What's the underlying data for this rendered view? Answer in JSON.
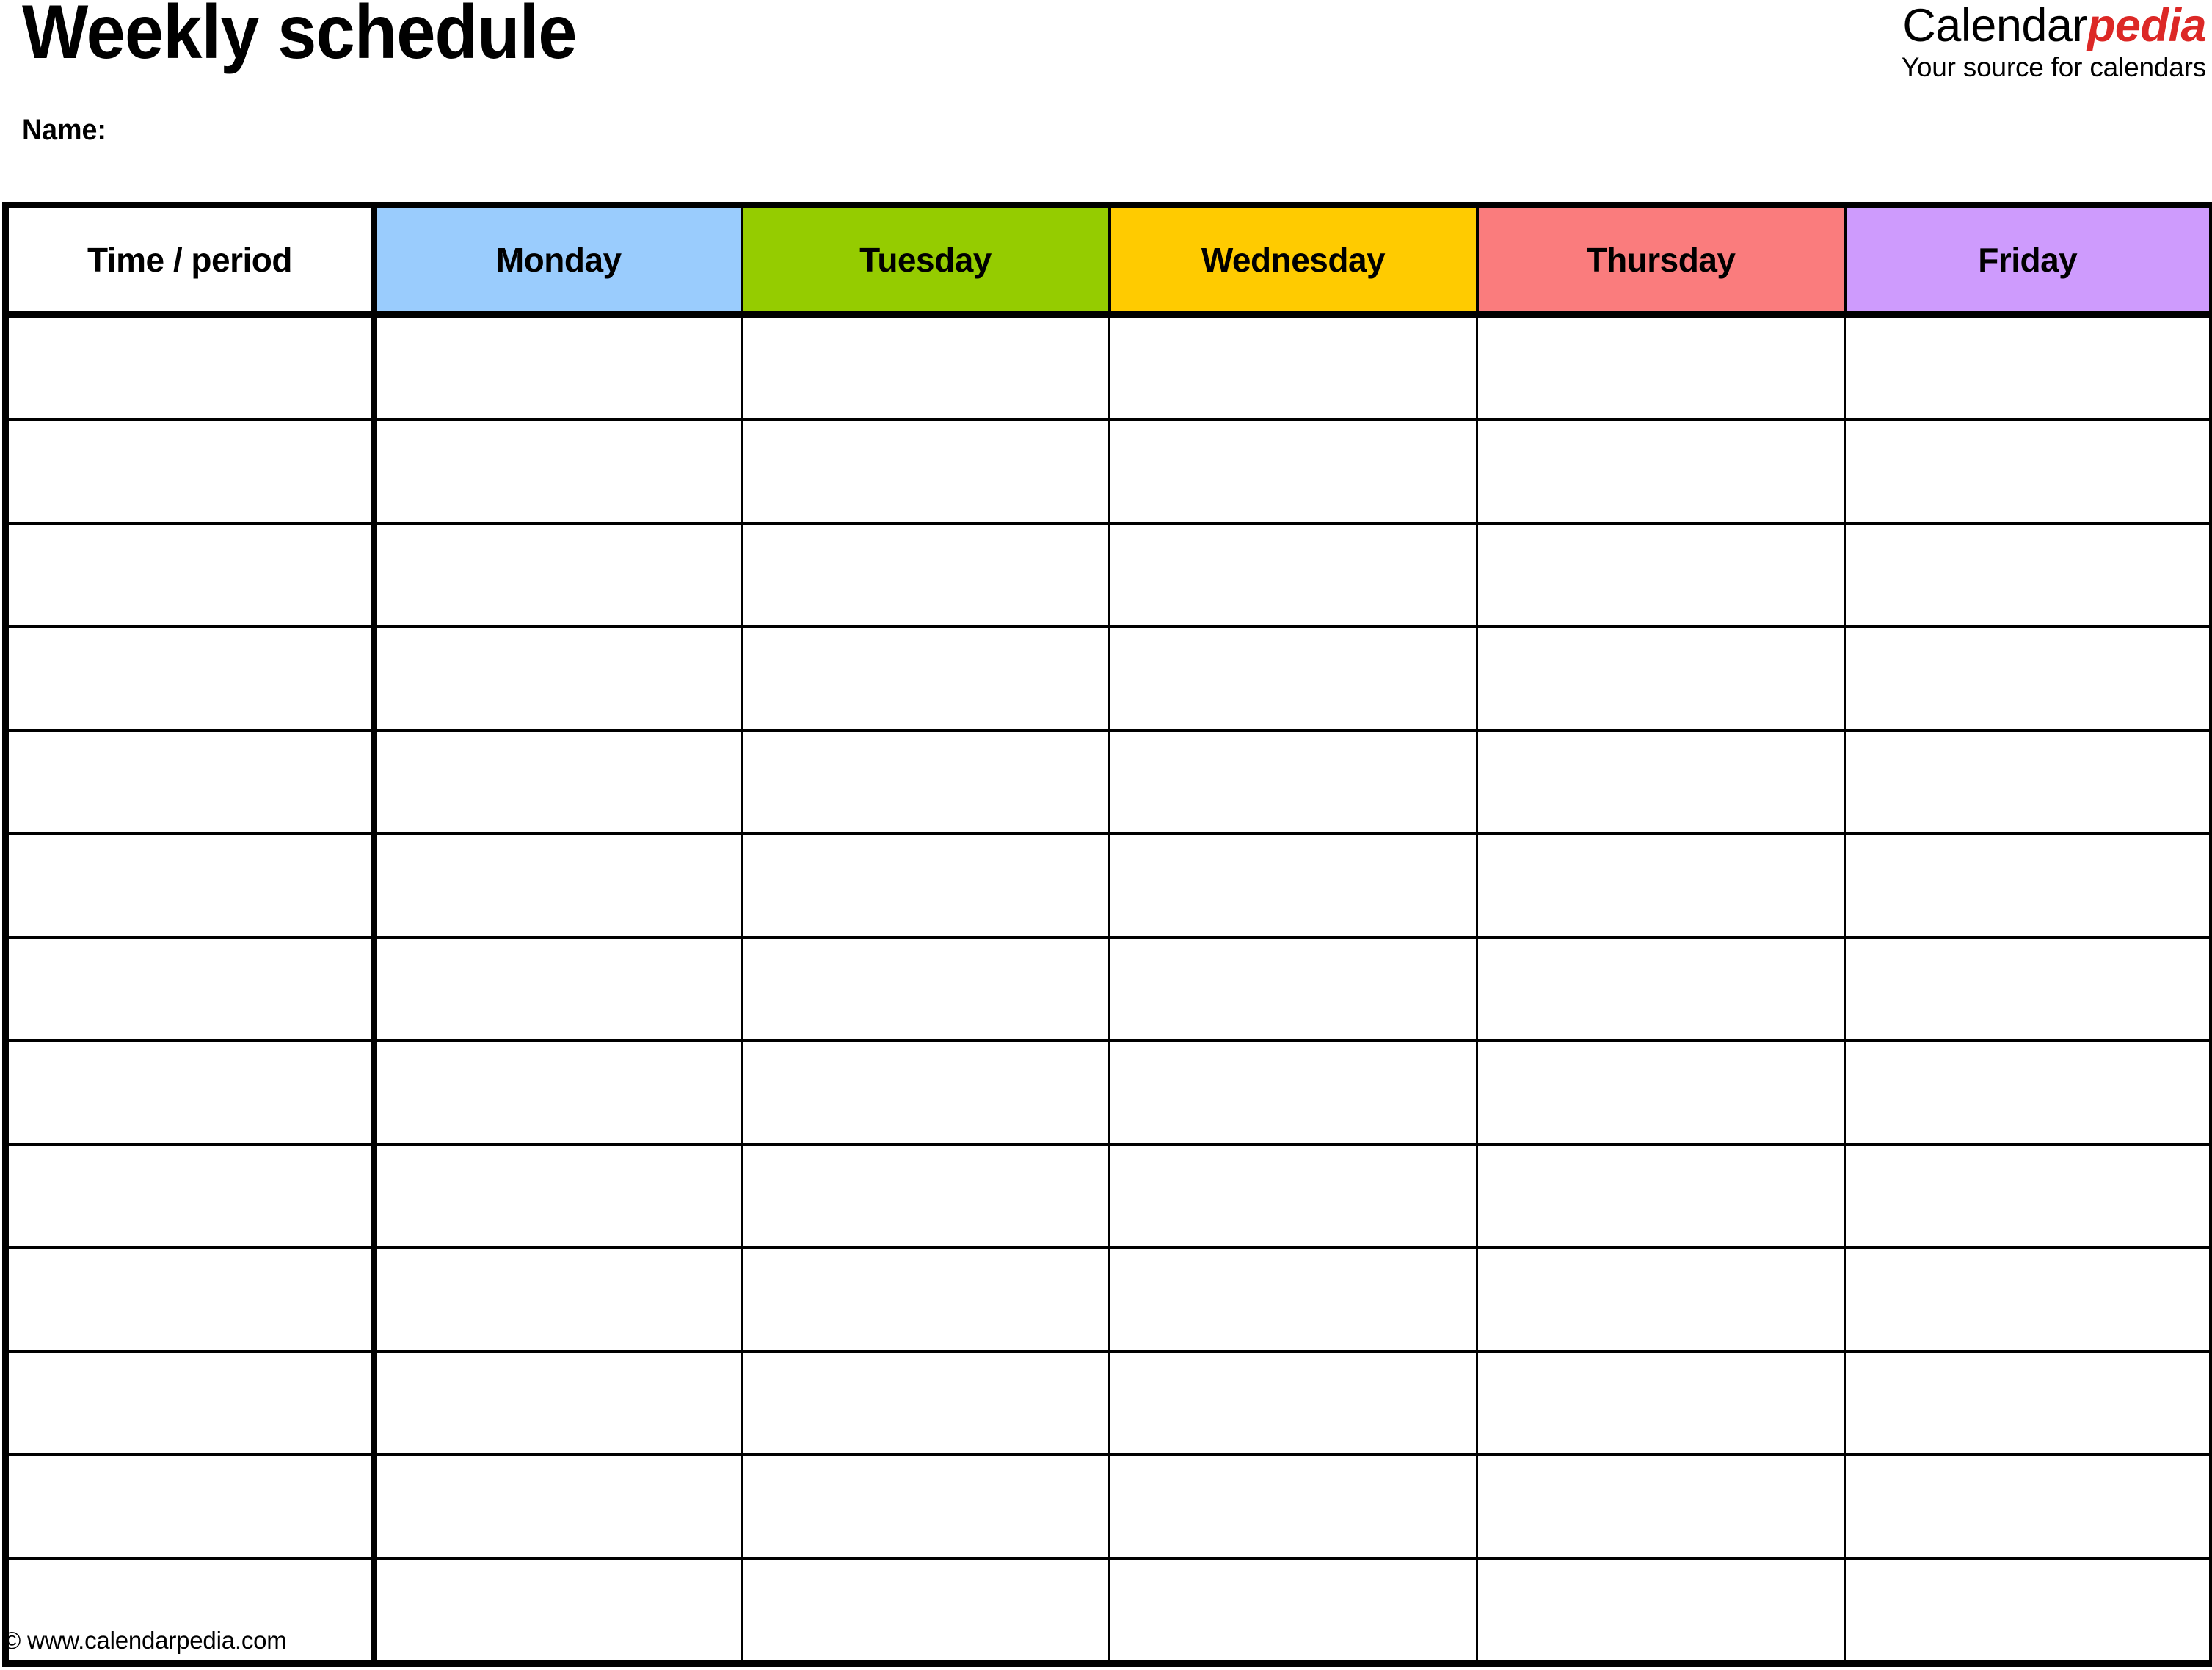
{
  "document": {
    "title": "Weekly schedule",
    "name_label": "Name:"
  },
  "brand": {
    "wordmark_part_1": "Calendar",
    "wordmark_part_2": "pedia",
    "tagline": "Your source for calendars",
    "accent_color": "#dc2826",
    "text_color": "#000000"
  },
  "table": {
    "columns": [
      {
        "label": "Time / period",
        "bg": "#ffffff",
        "key": "time"
      },
      {
        "label": "Monday",
        "bg": "#9accfd",
        "key": "monday"
      },
      {
        "label": "Tuesday",
        "bg": "#95cc00",
        "key": "tuesday"
      },
      {
        "label": "Wednesday",
        "bg": "#ffcb00",
        "key": "wednesday"
      },
      {
        "label": "Thursday",
        "bg": "#fa7c7d",
        "key": "thursday"
      },
      {
        "label": "Friday",
        "bg": "#ce9bfd",
        "key": "friday"
      }
    ],
    "row_count": 13,
    "rows": [
      {
        "time": "",
        "monday": "",
        "tuesday": "",
        "wednesday": "",
        "thursday": "",
        "friday": ""
      },
      {
        "time": "",
        "monday": "",
        "tuesday": "",
        "wednesday": "",
        "thursday": "",
        "friday": ""
      },
      {
        "time": "",
        "monday": "",
        "tuesday": "",
        "wednesday": "",
        "thursday": "",
        "friday": ""
      },
      {
        "time": "",
        "monday": "",
        "tuesday": "",
        "wednesday": "",
        "thursday": "",
        "friday": ""
      },
      {
        "time": "",
        "monday": "",
        "tuesday": "",
        "wednesday": "",
        "thursday": "",
        "friday": ""
      },
      {
        "time": "",
        "monday": "",
        "tuesday": "",
        "wednesday": "",
        "thursday": "",
        "friday": ""
      },
      {
        "time": "",
        "monday": "",
        "tuesday": "",
        "wednesday": "",
        "thursday": "",
        "friday": ""
      },
      {
        "time": "",
        "monday": "",
        "tuesday": "",
        "wednesday": "",
        "thursday": "",
        "friday": ""
      },
      {
        "time": "",
        "monday": "",
        "tuesday": "",
        "wednesday": "",
        "thursday": "",
        "friday": ""
      },
      {
        "time": "",
        "monday": "",
        "tuesday": "",
        "wednesday": "",
        "thursday": "",
        "friday": ""
      },
      {
        "time": "",
        "monday": "",
        "tuesday": "",
        "wednesday": "",
        "thursday": "",
        "friday": ""
      },
      {
        "time": "",
        "monday": "",
        "tuesday": "",
        "wednesday": "",
        "thursday": "",
        "friday": ""
      },
      {
        "time": "",
        "monday": "",
        "tuesday": "",
        "wednesday": "",
        "thursday": "",
        "friday": ""
      }
    ]
  },
  "footer": {
    "copyright": "© www.calendarpedia.com"
  }
}
